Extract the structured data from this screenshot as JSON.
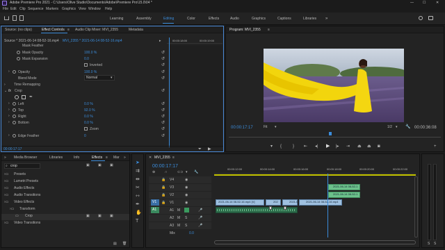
{
  "app": {
    "title": "Adobe Premiere Pro 2021 - C:\\Users\\Olive Studio\\Documents\\Adobe\\Premiere Pro\\15.0\\04 *",
    "window_controls": [
      "—",
      "☐",
      "✕"
    ]
  },
  "menu": [
    "File",
    "Edit",
    "Clip",
    "Sequence",
    "Markers",
    "Graphics",
    "View",
    "Window",
    "Help"
  ],
  "workspaces": {
    "tabs": [
      "Learning",
      "Assembly",
      "Editing",
      "Color",
      "Effects",
      "Audio",
      "Graphics",
      "Captions",
      "Libraries"
    ],
    "active": "Editing",
    "more": "»"
  },
  "effect_controls": {
    "tabs": [
      "Source: (no clips)",
      "Effect Controls",
      "Audio Clip Mixer: MVI_2355",
      "Metadata"
    ],
    "active_tab": "Effect Controls",
    "source_line": "Source * 2021-06-14 08-52-16.mp4",
    "clip_line": "MVI_2355 * 2021-06-14 08-52-16.mp4",
    "ruler_times": [
      "00:00:18:00",
      "00:00:19:00"
    ],
    "rows": {
      "mask_feather": "Mask Feather",
      "mask_opacity": "Mask Opacity",
      "mask_opacity_val": "100.0 %",
      "mask_expansion": "Mask Expansion",
      "mask_expansion_val": "0.0",
      "inverted": "Inverted",
      "opacity": "Opacity",
      "opacity_val": "100.0 %",
      "blend_mode": "Blend Mode",
      "blend_mode_val": "Normal",
      "time_remapping": "Time Remapping",
      "crop": "Crop",
      "left": "Left",
      "left_val": "0.0 %",
      "top": "Top",
      "top_val": "92.0 %",
      "right": "Right",
      "right_val": "0.0 %",
      "bottom": "Bottom",
      "bottom_val": "0.0 %",
      "zoom": "Zoom",
      "edge_feather": "Edge Feather",
      "edge_feather_val": "0"
    },
    "timecode": "00:00:17:17"
  },
  "program": {
    "title": "Program: MVI_2355",
    "timecode": "00:00:17:17",
    "fit": "Fit",
    "scale": "1/2",
    "duration": "00:00:36:08",
    "playhead_fraction": 0.48
  },
  "project": {
    "tabs": [
      "Media Browser",
      "Libraries",
      "Info",
      "Effects",
      "Mar"
    ],
    "active_tab": "Effects",
    "search_value": "crop",
    "tree": [
      {
        "label": "Presets",
        "level": 0
      },
      {
        "label": "Lumetri Presets",
        "level": 0
      },
      {
        "label": "Audio Effects",
        "level": 0
      },
      {
        "label": "Audio Transitions",
        "level": 0
      },
      {
        "label": "Video Effects",
        "level": 0
      },
      {
        "label": "Transform",
        "level": 1
      },
      {
        "label": "Crop",
        "level": 2
      },
      {
        "label": "Video Transitions",
        "level": 0
      }
    ]
  },
  "timeline": {
    "tab": "MVI_2355",
    "timecode": "00:00:17:17",
    "ruler": [
      "00:00:12:00",
      "00:00:14:00",
      "00:00:16:00",
      "00:00:18:00",
      "00:00:20:00",
      "00:00:22:00"
    ],
    "tracks": [
      "V4",
      "V3",
      "V2",
      "V1",
      "A1",
      "A2",
      "A3"
    ],
    "source_patch_v": "V1",
    "source_patch_a": "A1",
    "mix": "Mix",
    "mix_val": "0.0",
    "clips": {
      "v3": "2021-06-14 08-52-1",
      "v2": "2021-06-14 08-52-1",
      "v1a": "2021-06-14 08-52-16.mp4 [V]",
      "v1b": "202",
      "v1c": "2021-0",
      "v1d": "2021-06-14 08-52-16.mp4"
    }
  },
  "colors": {
    "accent": "#3b8ddc",
    "video_clip": "#9fc0df",
    "selected_clip": "#6cc18b",
    "audio_clip": "#2c6a4a",
    "panel_bg": "#232323"
  }
}
